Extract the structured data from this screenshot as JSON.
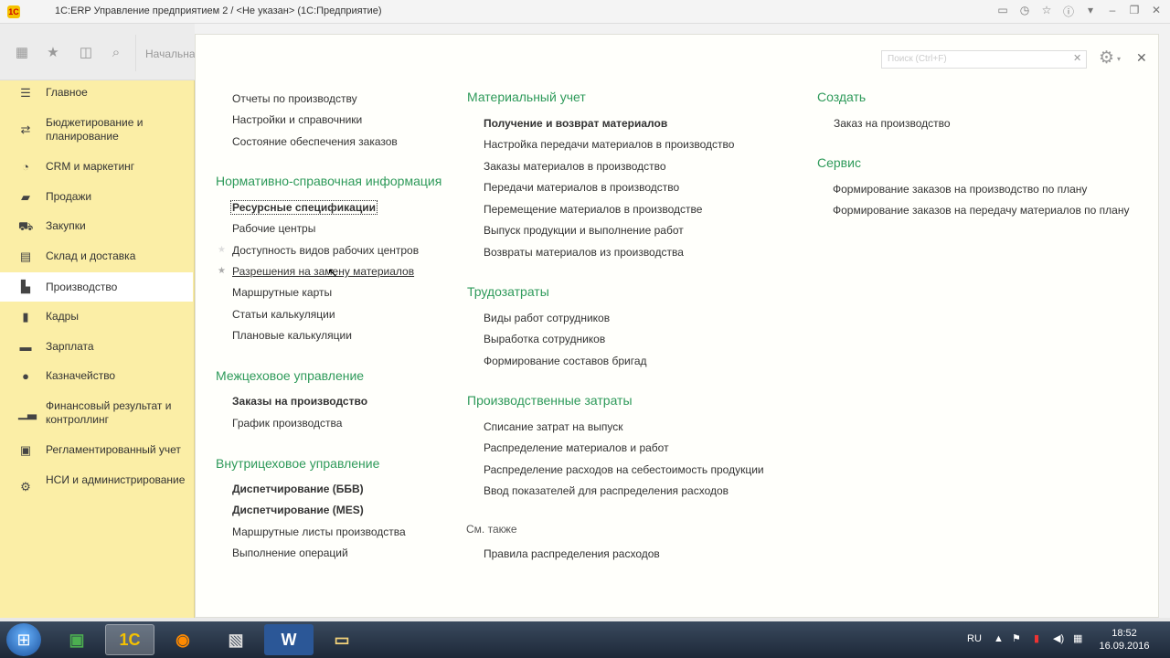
{
  "window": {
    "title": "1С:ERP Управление предприятием 2 / <Не указан>  (1С:Предприятие)"
  },
  "toolbar": {
    "start_tab": "Начальна"
  },
  "sidebar": {
    "items": [
      {
        "label": "Главное",
        "icon": "menu-icon"
      },
      {
        "label": "Бюджетирование и планирование",
        "icon": "budget-icon"
      },
      {
        "label": "CRM и маркетинг",
        "icon": "crm-icon"
      },
      {
        "label": "Продажи",
        "icon": "sales-icon"
      },
      {
        "label": "Закупки",
        "icon": "purchases-icon"
      },
      {
        "label": "Склад и доставка",
        "icon": "warehouse-icon"
      },
      {
        "label": "Производство",
        "icon": "factory-icon"
      },
      {
        "label": "Кадры",
        "icon": "staff-icon"
      },
      {
        "label": "Зарплата",
        "icon": "salary-icon"
      },
      {
        "label": "Казначейство",
        "icon": "treasury-icon"
      },
      {
        "label": "Финансовый результат и контроллинг",
        "icon": "chart-icon"
      },
      {
        "label": "Регламентированный учет",
        "icon": "accounting-icon"
      },
      {
        "label": "НСИ и администрирование",
        "icon": "gear-icon"
      }
    ],
    "active_index": 6
  },
  "main": {
    "search_placeholder": "Поиск (Ctrl+F)",
    "col1": {
      "top_links": [
        "Отчеты по производству",
        "Настройки и справочники",
        "Состояние обеспечения заказов"
      ],
      "nsi_title": "Нормативно-справочная информация",
      "nsi_links": [
        "Ресурсные спецификации",
        "Рабочие центры",
        "Доступность видов рабочих центров",
        "Разрешения на замену материалов",
        "Маршрутные карты",
        "Статьи калькуляции",
        "Плановые калькуляции"
      ],
      "inter_title": "Межцеховое управление",
      "inter_links": [
        "Заказы на производство",
        "График производства"
      ],
      "intra_title": "Внутрицеховое управление",
      "intra_links": [
        "Диспетчирование (ББВ)",
        "Диспетчирование (MES)",
        "Маршрутные листы производства",
        "Выполнение операций"
      ]
    },
    "col2": {
      "mat_title": "Материальный учет",
      "mat_links": [
        "Получение и возврат материалов",
        "Настройка передачи материалов в производство",
        "Заказы материалов в производство",
        "Передачи материалов в производство",
        "Перемещение материалов в производстве",
        "Выпуск продукции и выполнение работ",
        "Возвраты материалов из производства"
      ],
      "labor_title": "Трудозатраты",
      "labor_links": [
        "Виды работ сотрудников",
        "Выработка сотрудников",
        "Формирование составов бригад"
      ],
      "cost_title": "Производственные затраты",
      "cost_links": [
        "Списание затрат на выпуск",
        "Распределение материалов и работ",
        "Распределение расходов на себестоимость продукции",
        "Ввод показателей для распределения расходов"
      ],
      "see_also": "См. также",
      "see_also_links": [
        "Правила распределения расходов"
      ]
    },
    "col3": {
      "create_title": "Создать",
      "create_links": [
        "Заказ на производство"
      ],
      "service_title": "Сервис",
      "service_links": [
        "Формирование заказов на производство по плану",
        "Формирование заказов на передачу материалов по плану"
      ]
    }
  },
  "taskbar": {
    "lang": "RU",
    "time": "18:52",
    "date": "16.09.2016"
  }
}
